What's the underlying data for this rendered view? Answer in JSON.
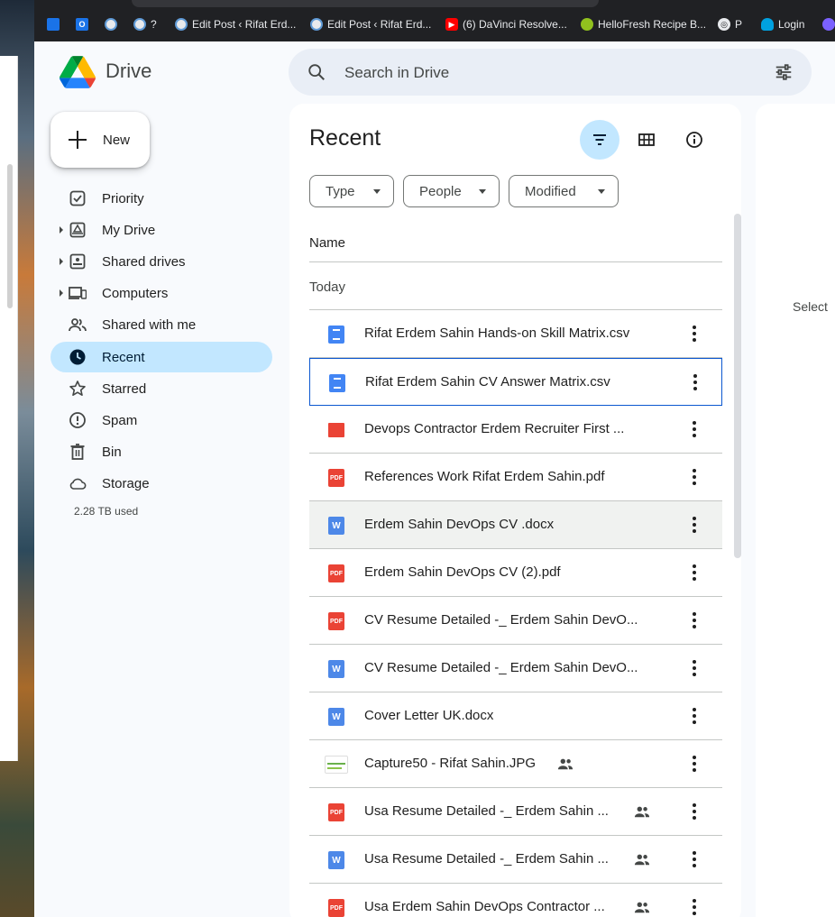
{
  "bookmarks": [
    {
      "icon": "square-blue-icon",
      "label": ""
    },
    {
      "icon": "outlook-icon",
      "label": "O"
    },
    {
      "icon": "wordpress-icon",
      "label": ""
    },
    {
      "icon": "wordpress-icon",
      "label": "?"
    },
    {
      "icon": "wordpress-icon",
      "label": "Edit Post ‹ Rifat Erd..."
    },
    {
      "icon": "wordpress-icon",
      "label": "Edit Post ‹ Rifat Erd..."
    },
    {
      "icon": "youtube-icon",
      "label": "(6) DaVinci Resolve..."
    },
    {
      "icon": "hellofresh-icon",
      "label": "HelloFresh Recipe B..."
    },
    {
      "icon": "globe-icon",
      "label": "P"
    },
    {
      "icon": "salesforce-icon",
      "label": "Login"
    }
  ],
  "header": {
    "brand": "Drive",
    "search_placeholder": "Search in Drive"
  },
  "sidebar": {
    "new_label": "New",
    "items": [
      {
        "label": "Priority",
        "icon": "priority-icon",
        "expandable": false,
        "active": false
      },
      {
        "label": "My Drive",
        "icon": "my-drive-icon",
        "expandable": true,
        "active": false
      },
      {
        "label": "Shared drives",
        "icon": "shared-drives-icon",
        "expandable": true,
        "active": false
      },
      {
        "label": "Computers",
        "icon": "computers-icon",
        "expandable": true,
        "active": false
      },
      {
        "label": "Shared with me",
        "icon": "shared-with-me-icon",
        "expandable": false,
        "active": false
      },
      {
        "label": "Recent",
        "icon": "clock-icon",
        "expandable": false,
        "active": true
      },
      {
        "label": "Starred",
        "icon": "star-icon",
        "expandable": false,
        "active": false
      },
      {
        "label": "Spam",
        "icon": "spam-icon",
        "expandable": false,
        "active": false
      },
      {
        "label": "Bin",
        "icon": "bin-icon",
        "expandable": false,
        "active": false
      },
      {
        "label": "Storage",
        "icon": "cloud-icon",
        "expandable": false,
        "active": false
      }
    ],
    "storage_used": "2.28 TB used"
  },
  "main": {
    "title": "Recent",
    "filters": [
      "Type",
      "People",
      "Modified"
    ],
    "column_name": "Name",
    "group_label": "Today",
    "files": [
      {
        "name": "Rifat Erdem Sahin Hands-on Skill Matrix.csv",
        "type": "doc",
        "shared": false
      },
      {
        "name": "Rifat Erdem Sahin CV Answer Matrix.csv",
        "type": "doc",
        "shared": false
      },
      {
        "name": "Devops Contractor Erdem Recruiter First ...",
        "type": "video",
        "shared": false
      },
      {
        "name": "References Work Rifat Erdem Sahin.pdf",
        "type": "pdf",
        "shared": false
      },
      {
        "name": "Erdem Sahin DevOps CV .docx",
        "type": "word",
        "shared": false
      },
      {
        "name": "Erdem Sahin DevOps CV  (2).pdf",
        "type": "pdf",
        "shared": false
      },
      {
        "name": "CV Resume Detailed -_ Erdem Sahin DevO...",
        "type": "pdf",
        "shared": false
      },
      {
        "name": "CV Resume Detailed -_ Erdem Sahin DevO...",
        "type": "word",
        "shared": false
      },
      {
        "name": "Cover Letter UK.docx",
        "type": "word",
        "shared": false
      },
      {
        "name": "Capture50 - Rifat Sahin.JPG",
        "type": "image",
        "shared": true
      },
      {
        "name": "Usa Resume Detailed -_ Erdem Sahin ...",
        "type": "pdf",
        "shared": true
      },
      {
        "name": "Usa Resume Detailed -_ Erdem Sahin ...",
        "type": "word",
        "shared": true
      },
      {
        "name": "Usa Erdem Sahin DevOps Contractor ...",
        "type": "pdf",
        "shared": true
      }
    ]
  },
  "details": {
    "select_text": "Select"
  },
  "icon_text": {
    "pdf": "PDF",
    "word": "W"
  },
  "colors": {
    "accent": "#c2e7ff",
    "search_bg": "#e9eef6",
    "focus": "#0b57d0"
  }
}
